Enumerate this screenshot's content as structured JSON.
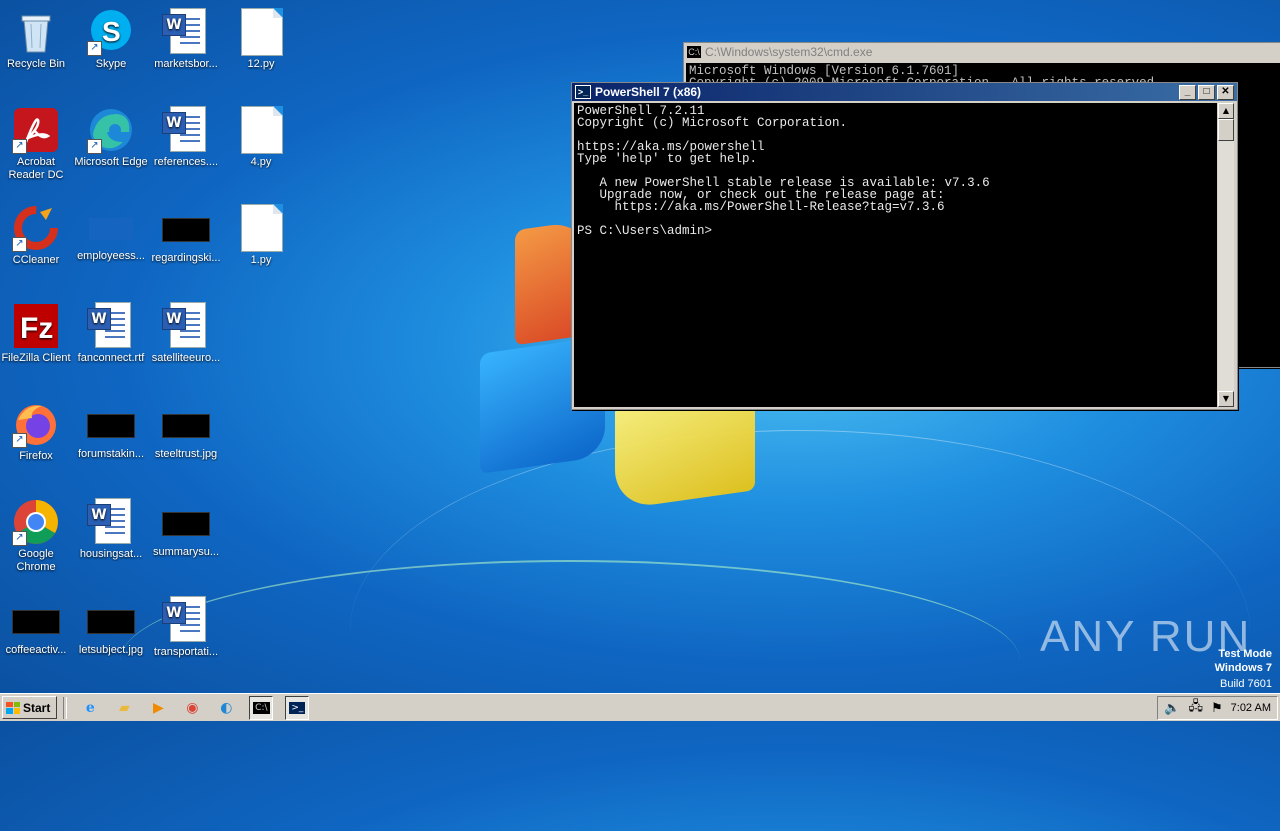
{
  "desktop": {
    "icons": [
      {
        "label": "Recycle Bin",
        "icon": "recycle-bin-icon"
      },
      {
        "label": "Skype",
        "icon": "skype-icon"
      },
      {
        "label": "marketsbor...",
        "icon": "word-document-icon"
      },
      {
        "label": "12.py",
        "icon": "file-icon"
      },
      {
        "label": "Acrobat Reader DC",
        "icon": "acrobat-icon"
      },
      {
        "label": "Microsoft Edge",
        "icon": "edge-icon"
      },
      {
        "label": "references....",
        "icon": "word-document-icon"
      },
      {
        "label": "4.py",
        "icon": "file-icon"
      },
      {
        "label": "CCleaner",
        "icon": "ccleaner-icon"
      },
      {
        "label": "employeess...",
        "icon": "image-thumbnail-icon"
      },
      {
        "label": "regardingski...",
        "icon": "image-thumbnail-icon"
      },
      {
        "label": "1.py",
        "icon": "file-icon"
      },
      {
        "label": "FileZilla Client",
        "icon": "filezilla-icon"
      },
      {
        "label": "fanconnect.rtf",
        "icon": "word-document-icon"
      },
      {
        "label": "satelliteeuro...",
        "icon": "word-document-icon"
      },
      {
        "label": "Firefox",
        "icon": "firefox-icon"
      },
      {
        "label": "forumstakin...",
        "icon": "image-thumbnail-icon"
      },
      {
        "label": "steeltrust.jpg",
        "icon": "image-thumbnail-icon"
      },
      {
        "label": "Google Chrome",
        "icon": "chrome-icon"
      },
      {
        "label": "housingsat...",
        "icon": "word-document-icon"
      },
      {
        "label": "summarysu...",
        "icon": "image-thumbnail-icon"
      },
      {
        "label": "coffeeactiv...",
        "icon": "image-thumbnail-icon"
      },
      {
        "label": "letsubject.jpg",
        "icon": "image-thumbnail-icon"
      },
      {
        "label": "transportati...",
        "icon": "word-document-icon"
      }
    ]
  },
  "cmd_window": {
    "title": "C:\\Windows\\system32\\cmd.exe",
    "line1": "Microsoft Windows [Version 6.1.7601]",
    "line2": "Copyright (c) 2009 Microsoft Corporation.  All rights reserved."
  },
  "powershell_window": {
    "title": "PowerShell 7 (x86)",
    "lines": [
      "PowerShell 7.2.11",
      "Copyright (c) Microsoft Corporation.",
      "",
      "https://aka.ms/powershell",
      "Type 'help' to get help.",
      "",
      "   A new PowerShell stable release is available: v7.3.6",
      "   Upgrade now, or check out the release page at:",
      "     https://aka.ms/PowerShell-Release?tag=v7.3.6",
      "",
      "PS C:\\Users\\admin>"
    ]
  },
  "taskbar": {
    "start_label": "Start",
    "pinned": [
      "internet-explorer-icon",
      "folder-icon",
      "media-player-icon",
      "chrome-icon",
      "edge-icon",
      "cmd-icon",
      "powershell-icon"
    ],
    "clock": "7:02 AM"
  },
  "watermark": {
    "line1": "Test Mode",
    "line2": "Windows 7",
    "line3": "Build 7601",
    "brand": "ANY RUN"
  }
}
